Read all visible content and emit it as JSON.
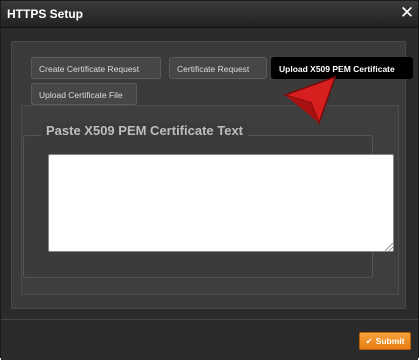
{
  "dialog": {
    "title": "HTTPS Setup",
    "close_icon": "close-icon"
  },
  "tabs": [
    {
      "label": "Create Certificate Request",
      "active": false
    },
    {
      "label": "Certificate Request",
      "active": false
    },
    {
      "label": "Upload X509 PEM Certificate",
      "active": true
    },
    {
      "label": "Upload Certificate File",
      "active": false
    }
  ],
  "panel": {
    "legend": "Paste X509 PEM Certificate Text",
    "textarea_value": "",
    "textarea_placeholder": ""
  },
  "footer": {
    "submit_label": "Submit",
    "submit_icon": "check-icon"
  },
  "colors": {
    "accent": "#f08c22",
    "dialog_bg": "#2b2b2b",
    "active_tab": "#000000",
    "pointer": "#d81f1f"
  }
}
